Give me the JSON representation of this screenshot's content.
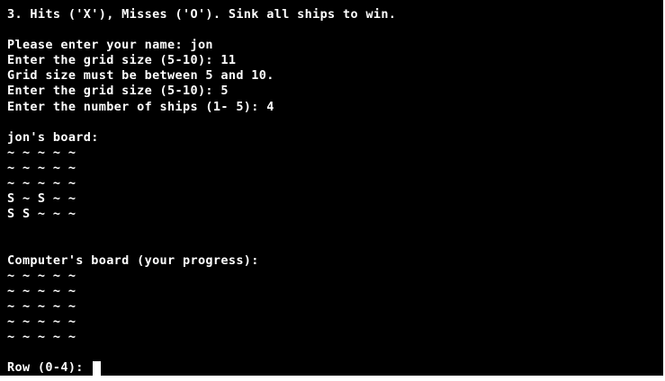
{
  "terminal": {
    "intro_line": "3. Hits ('X'), Misses ('O'). Sink all ships to win.",
    "prompts": [
      "Please enter your name: jon",
      "Enter the grid size (5-10): 11",
      "Grid size must be between 5 and 10.",
      "Enter the grid size (5-10): 5",
      "Enter the number of ships (1- 5): 4"
    ],
    "player_board": {
      "title": "jon's board:",
      "rows": [
        "~ ~ ~ ~ ~",
        "~ ~ ~ ~ ~",
        "~ ~ ~ ~ ~",
        "S ~ S ~ ~",
        "S S ~ ~ ~"
      ]
    },
    "computer_board": {
      "title": "Computer's board (your progress):",
      "rows": [
        "~ ~ ~ ~ ~",
        "~ ~ ~ ~ ~",
        "~ ~ ~ ~ ~",
        "~ ~ ~ ~ ~",
        "~ ~ ~ ~ ~"
      ]
    },
    "input_prompt": "Row (0-4): ",
    "colors": {
      "background": "#000000",
      "text": "#ffffff"
    }
  }
}
